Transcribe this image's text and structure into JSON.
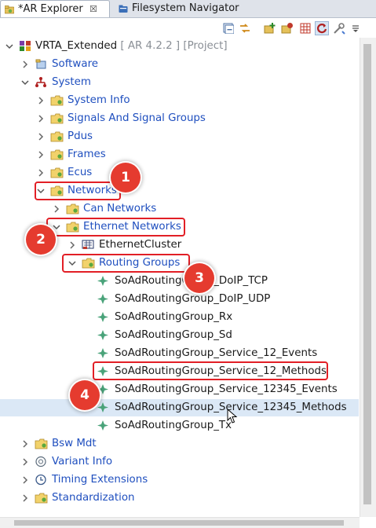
{
  "tabs": [
    {
      "label": "*AR Explorer",
      "close": "☒",
      "icon": "ar-explorer-icon"
    },
    {
      "label": "Filesystem Navigator",
      "icon": "filesystem-navigator-icon"
    }
  ],
  "toolbar": [
    {
      "icon": "collapse-all-icon"
    },
    {
      "icon": "link-with-editor-icon"
    },
    {
      "icon": "add-element-icon"
    },
    {
      "icon": "add-child-icon"
    },
    {
      "icon": "grid-icon"
    },
    {
      "icon": "refresh-icon"
    },
    {
      "icon": "tools-icon"
    },
    {
      "icon": "view-menu-icon"
    }
  ],
  "tree": {
    "root": {
      "label": "VRTA_Extended",
      "suffix": "[ AR 4.2.2 ] [Project]"
    },
    "software": "Software",
    "system": "System",
    "system_info": "System Info",
    "signals": "Signals And Signal Groups",
    "pdus": "Pdus",
    "frames": "Frames",
    "ecus": "Ecus",
    "networks": "Networks",
    "can_networks": "Can Networks",
    "ethernet_networks": "Ethernet Networks",
    "ethernet_cluster": "EthernetCluster",
    "routing_groups": "Routing Groups",
    "rg_items": [
      "SoAdRoutingGroup_DoIP_TCP",
      "SoAdRoutingGroup_DoIP_UDP",
      "SoAdRoutingGroup_Rx",
      "SoAdRoutingGroup_Sd",
      "SoAdRoutingGroup_Service_12_Events",
      "SoAdRoutingGroup_Service_12_Methods",
      "SoAdRoutingGroup_Service_12345_Events",
      "SoAdRoutingGroup_Service_12345_Methods",
      "SoAdRoutingGroup_Tx"
    ],
    "bsw_mdt": "Bsw Mdt",
    "variant_info": "Variant Info",
    "timing_extensions": "Timing Extensions",
    "standardization": "Standardization"
  },
  "callouts": [
    "1",
    "2",
    "3",
    "4"
  ],
  "colors": {
    "highlight": "#e21f26",
    "badge": "#e53b2f",
    "link_text": "#1f4fbf"
  }
}
